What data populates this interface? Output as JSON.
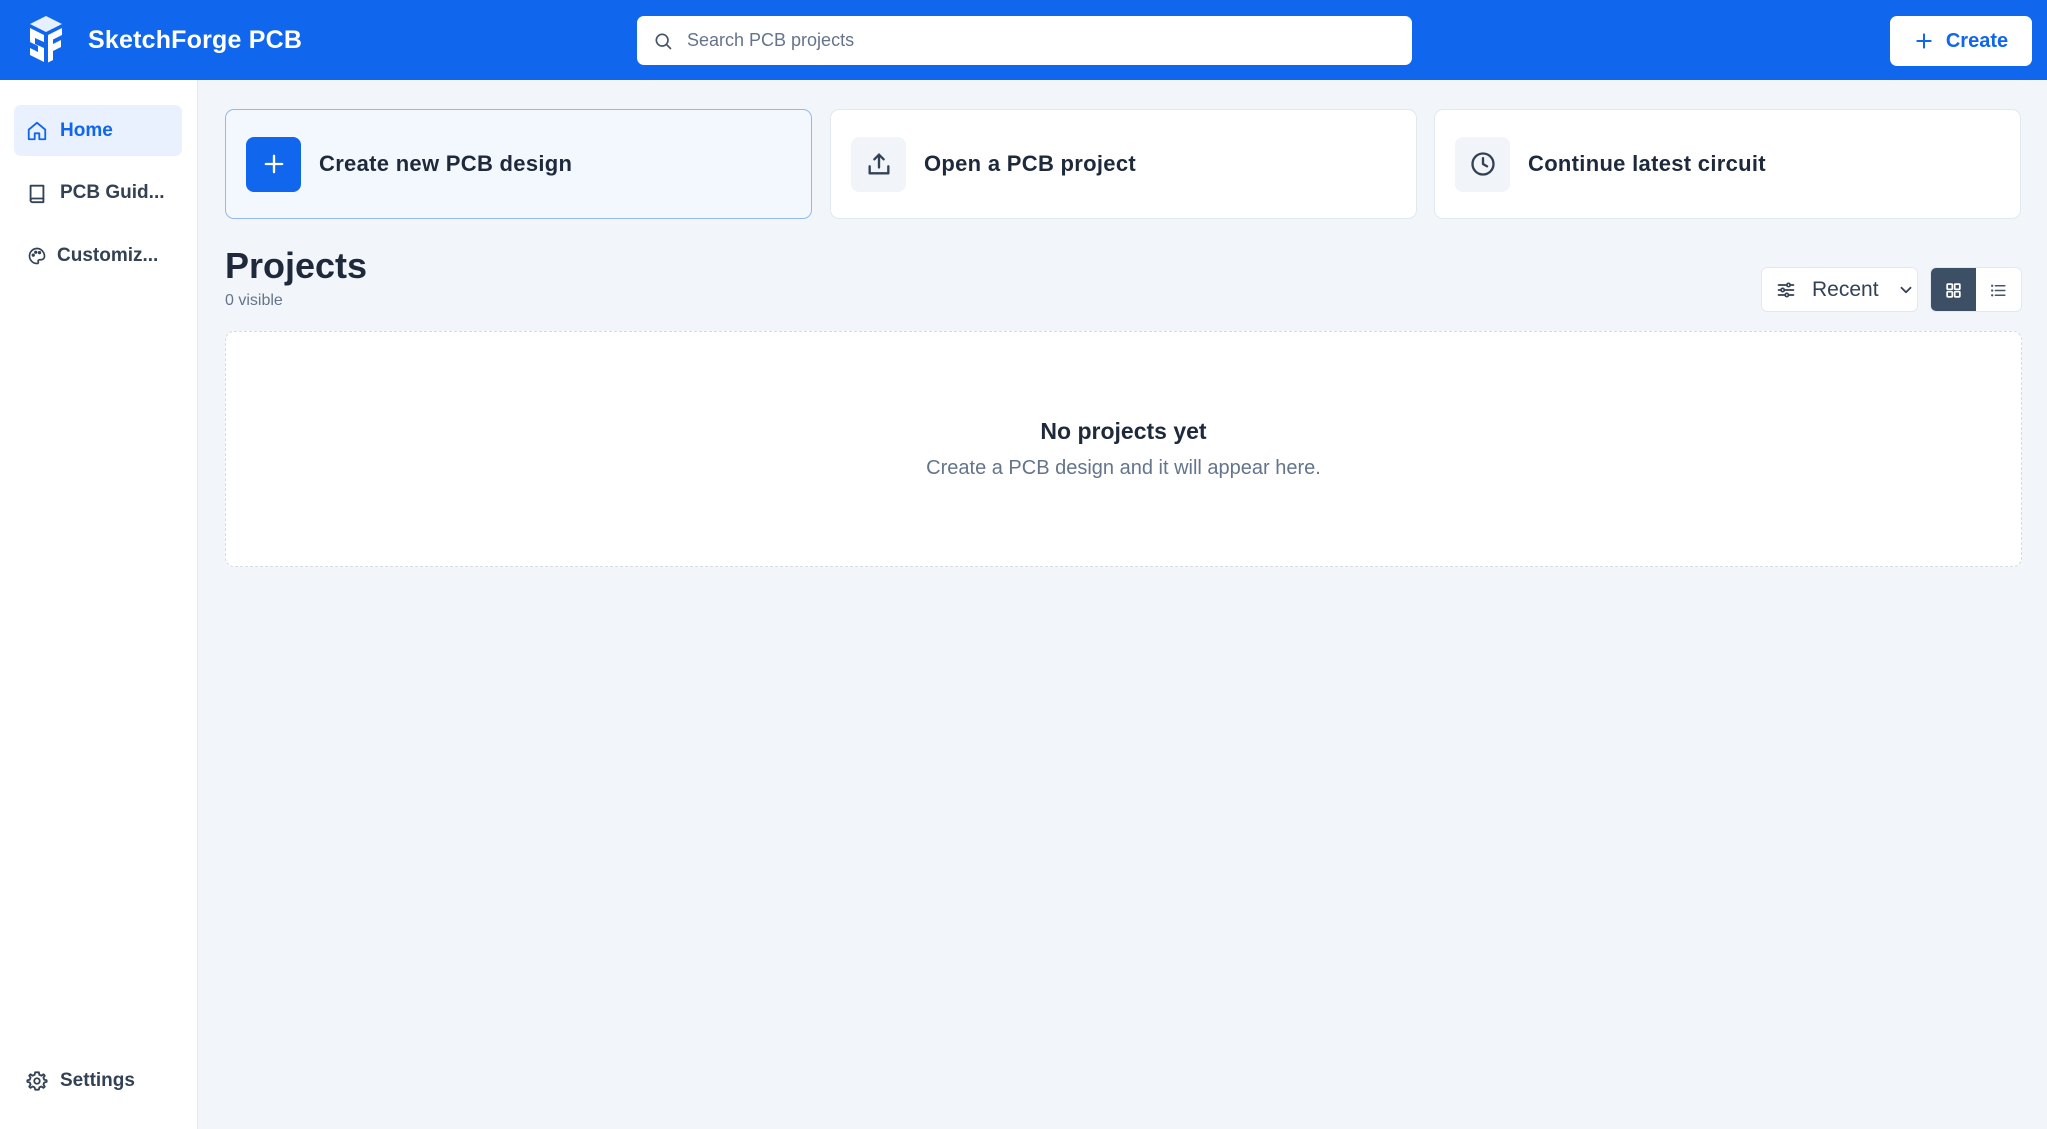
{
  "header": {
    "brand_name": "SketchForge PCB",
    "search_placeholder": "Search PCB projects",
    "create_label": "Create"
  },
  "sidebar": {
    "items": [
      {
        "label": "Home",
        "icon": "home-icon",
        "active": true
      },
      {
        "label": "PCB Guid...",
        "icon": "book-icon"
      },
      {
        "label": "Customiz...",
        "icon": "palette-icon"
      }
    ],
    "settings_label": "Settings"
  },
  "quick_actions": [
    {
      "label": "Create new PCB design",
      "icon": "plus-icon"
    },
    {
      "label": "Open a PCB project",
      "icon": "upload-icon"
    },
    {
      "label": "Continue latest circuit",
      "icon": "clock-icon"
    }
  ],
  "projects": {
    "title": "Projects",
    "count_text": "0 visible",
    "sort_label": "Recent",
    "view_modes": [
      "grid",
      "list"
    ],
    "active_view": "grid",
    "empty_title": "No projects yet",
    "empty_subtitle": "Create a PCB design and it will appear here."
  },
  "colors": {
    "brand": "#1166ee",
    "background": "#f2f6fa",
    "active_view": "#3d4f64"
  }
}
